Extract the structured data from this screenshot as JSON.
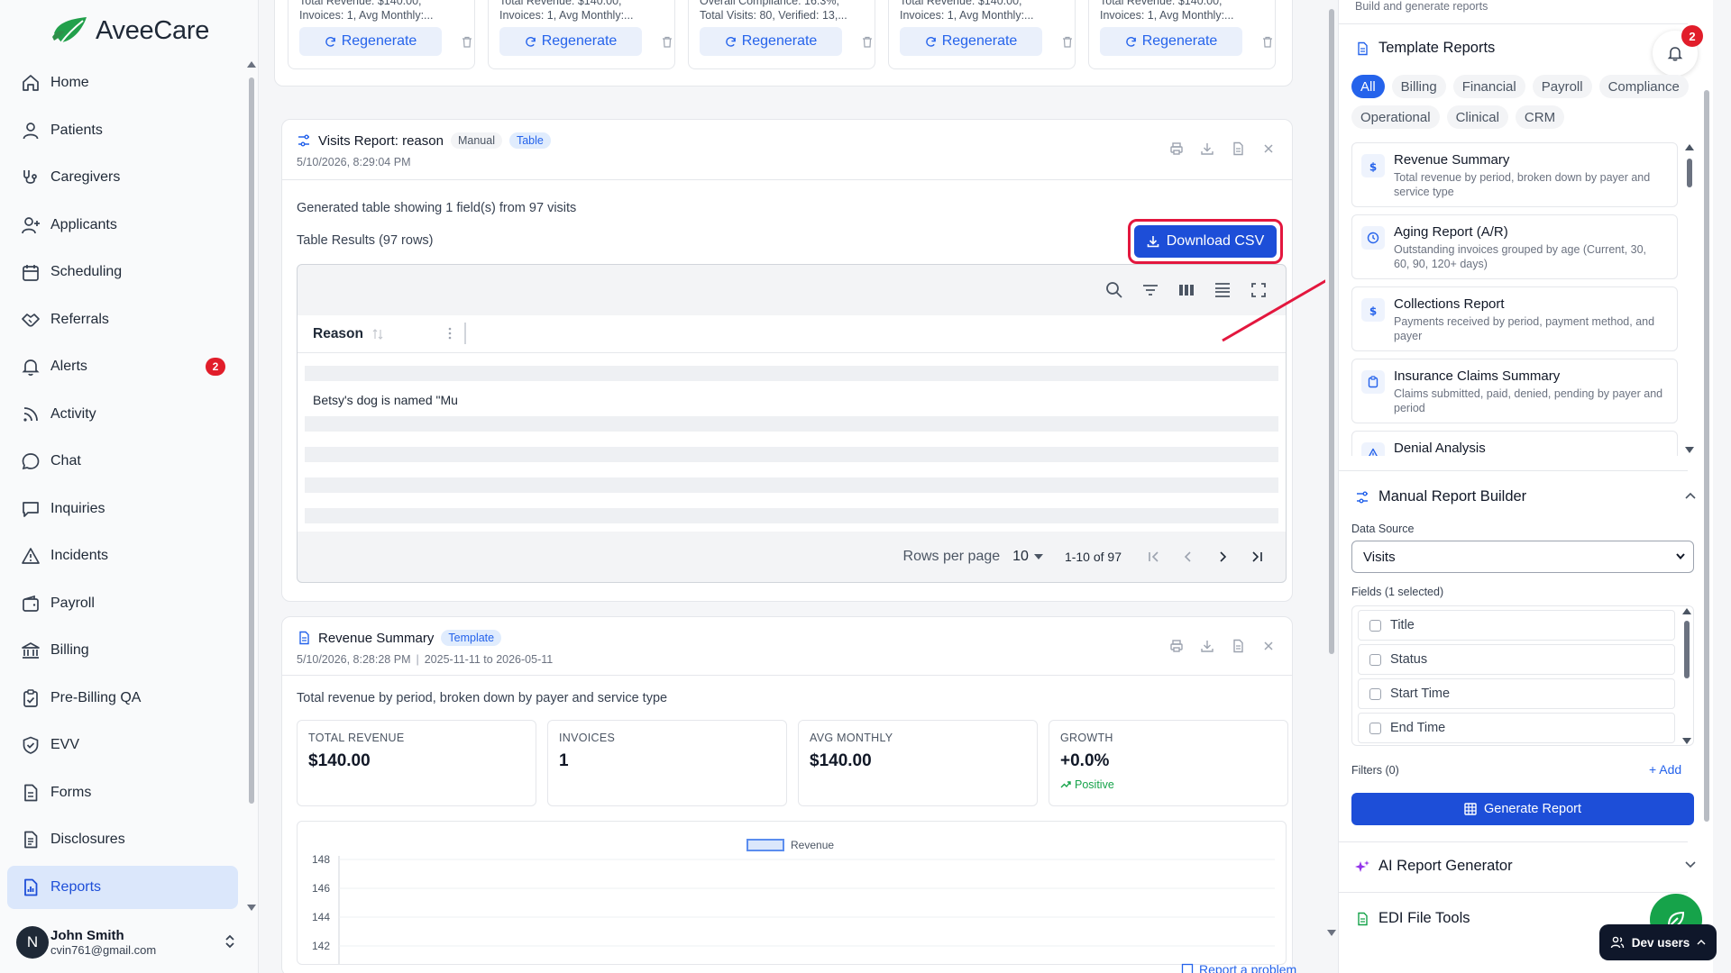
{
  "app": {
    "name": "AveeCare"
  },
  "nav": {
    "items": [
      {
        "label": "Home",
        "icon": "home-icon"
      },
      {
        "label": "Patients",
        "icon": "user-icon"
      },
      {
        "label": "Caregivers",
        "icon": "stethoscope-icon"
      },
      {
        "label": "Applicants",
        "icon": "user-plus-icon"
      },
      {
        "label": "Scheduling",
        "icon": "calendar-icon"
      },
      {
        "label": "Referrals",
        "icon": "handshake-icon"
      },
      {
        "label": "Alerts",
        "icon": "bell-icon",
        "badge": "2"
      },
      {
        "label": "Activity",
        "icon": "rss-icon"
      },
      {
        "label": "Chat",
        "icon": "chat-icon"
      },
      {
        "label": "Inquiries",
        "icon": "message-square-icon"
      },
      {
        "label": "Incidents",
        "icon": "warning-icon"
      },
      {
        "label": "Payroll",
        "icon": "wallet-icon"
      },
      {
        "label": "Billing",
        "icon": "landmark-icon"
      },
      {
        "label": "Pre-Billing QA",
        "icon": "clipboard-check-icon"
      },
      {
        "label": "EVV",
        "icon": "shield-check-icon"
      },
      {
        "label": "Forms",
        "icon": "file-text-icon"
      },
      {
        "label": "Disclosures",
        "icon": "file-list-icon"
      },
      {
        "label": "Reports",
        "icon": "report-icon",
        "active": true
      }
    ]
  },
  "user": {
    "initial": "N",
    "name": "John Smith",
    "email": "cvin761@gmail.com"
  },
  "mini_cards": [
    {
      "line1": "Total Revenue: $140.00,",
      "line2": "Invoices: 1, Avg Monthly:...",
      "button": "Regenerate"
    },
    {
      "line1": "Total Revenue: $140.00,",
      "line2": "Invoices: 1, Avg Monthly:...",
      "button": "Regenerate"
    },
    {
      "line1": "Overall Compliance: 16.3%,",
      "line2": "Total Visits: 80, Verified: 13,...",
      "button": "Regenerate"
    },
    {
      "line1": "Total Revenue: $140.00,",
      "line2": "Invoices: 1, Avg Monthly:...",
      "button": "Regenerate"
    },
    {
      "line1": "Total Revenue: $140.00,",
      "line2": "Invoices: 1, Avg Monthly:...",
      "button": "Regenerate"
    }
  ],
  "visits_report": {
    "title": "Visits Report: reason",
    "tag1": "Manual",
    "tag2": "Table",
    "timestamp": "5/10/2026, 8:29:04 PM",
    "description": "Generated table showing 1 field(s) from 97 visits",
    "table_results": "Table Results (97 rows)",
    "download_label": "Download CSV",
    "column": "Reason",
    "cell": "Betsy's dog is named \"Mu",
    "rows_per_page_label": "Rows per page",
    "rows_per_page_value": "10",
    "range": "1-10 of 97"
  },
  "revenue_summary": {
    "title": "Revenue Summary",
    "tag": "Template",
    "timestamp": "5/10/2026, 8:28:28 PM",
    "period": "2025-11-11 to 2026-05-11",
    "description": "Total revenue by period, broken down by payer and service type",
    "stats": [
      {
        "label": "TOTAL REVENUE",
        "value": "$140.00"
      },
      {
        "label": "INVOICES",
        "value": "1"
      },
      {
        "label": "AVG MONTHLY",
        "value": "$140.00"
      },
      {
        "label": "GROWTH",
        "value": "+0.0%",
        "trend": "Positive"
      }
    ]
  },
  "chart_data": {
    "type": "bar",
    "title": "",
    "xlabel": "",
    "ylabel": "",
    "series": [
      {
        "name": "Revenue",
        "values": []
      }
    ],
    "y_ticks": [
      148,
      146,
      144,
      142
    ],
    "ylim": [
      142,
      148
    ],
    "legend": "top-center",
    "grid": true,
    "colors": {
      "Revenue": "#5b8def"
    }
  },
  "report_problem": "Report a problem",
  "right_panel": {
    "top_text": "Build and generate reports",
    "bell_badge": "2",
    "template_reports": "Template Reports",
    "chips": [
      "All",
      "Billing",
      "Financial",
      "Payroll",
      "Compliance",
      "Operational",
      "Clinical",
      "CRM"
    ],
    "templates": [
      {
        "title": "Revenue Summary",
        "desc": "Total revenue by period, broken down by payer and service type",
        "icon": "dollar-icon"
      },
      {
        "title": "Aging Report (A/R)",
        "desc": "Outstanding invoices grouped by age (Current, 30, 60, 90, 120+ days)",
        "icon": "clock-icon"
      },
      {
        "title": "Collections Report",
        "desc": "Payments received by period, payment method, and payer",
        "icon": "dollar-icon"
      },
      {
        "title": "Insurance Claims Summary",
        "desc": "Claims submitted, paid, denied, pending by payer and period",
        "icon": "clipboard-icon"
      },
      {
        "title": "Denial Analysis",
        "desc": "",
        "icon": "alert-triangle-icon"
      }
    ],
    "manual_builder": "Manual Report Builder",
    "data_source_label": "Data Source",
    "data_source_value": "Visits",
    "fields_label": "Fields (1 selected)",
    "fields": [
      "Title",
      "Status",
      "Start Time",
      "End Time"
    ],
    "filters_label": "Filters (0)",
    "add_label": "+ Add",
    "generate_label": "Generate Report",
    "ai_generator": "AI Report Generator",
    "edi_tools": "EDI File Tools",
    "dev_users": "Dev users"
  }
}
